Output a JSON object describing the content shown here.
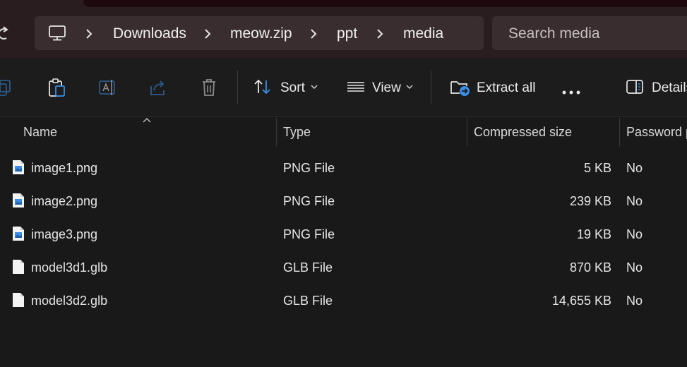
{
  "breadcrumb": [
    "Downloads",
    "meow.zip",
    "ppt",
    "media"
  ],
  "search": {
    "placeholder": "Search media"
  },
  "toolbar": {
    "sort_label": "Sort",
    "view_label": "View",
    "extract_label": "Extract all",
    "details_label": "Details"
  },
  "columns": {
    "name": "Name",
    "type": "Type",
    "compressed": "Compressed size",
    "password": "Password p"
  },
  "files": [
    {
      "name": "image1.png",
      "type": "PNG File",
      "size": "5 KB",
      "password": "No",
      "icon": "image-file-icon"
    },
    {
      "name": "image2.png",
      "type": "PNG File",
      "size": "239 KB",
      "password": "No",
      "icon": "image-file-icon"
    },
    {
      "name": "image3.png",
      "type": "PNG File",
      "size": "19 KB",
      "password": "No",
      "icon": "image-file-icon"
    },
    {
      "name": "model3d1.glb",
      "type": "GLB File",
      "size": "870 KB",
      "password": "No",
      "icon": "blank-file-icon"
    },
    {
      "name": "model3d2.glb",
      "type": "GLB File",
      "size": "14,655 KB",
      "password": "No",
      "icon": "blank-file-icon"
    }
  ],
  "colors": {
    "accent": "#3a8ee6",
    "background": "#191919",
    "titlebar": "#2a1d20"
  }
}
